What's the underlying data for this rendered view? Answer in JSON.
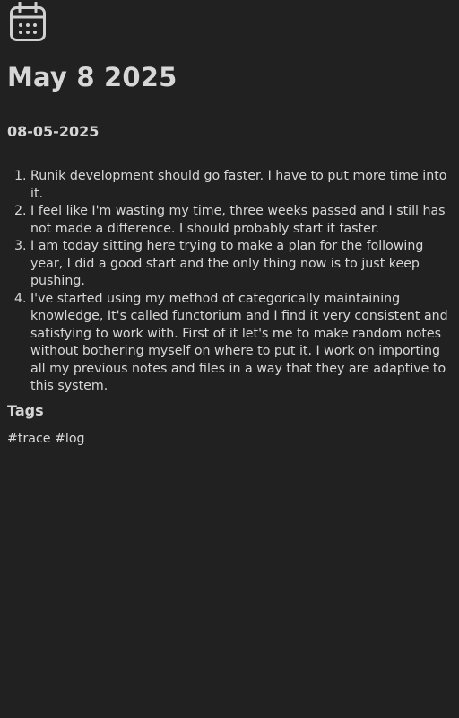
{
  "header": {
    "icon": "calendar-icon",
    "title": "May 8 2025"
  },
  "date_heading": "08-05-2025",
  "entries": [
    "Runik development should go faster. I have to put more time into it.",
    "I feel like I'm wasting my time, three weeks passed and I still has not made a difference. I should probably start it faster.",
    "I am today sitting here trying to make a plan for the following year, I did a good start and the only thing now is to just keep pushing.",
    "I've started using my method of categorically maintaining knowledge, It's called functorium and I find it very consistent and satisfying to work with. First of it let's me to make random notes without bothering myself on where to put it. I work on importing all my previous notes and files in a way that they are adaptive to this system."
  ],
  "tags_section": {
    "heading": "Tags",
    "tags": [
      "#trace",
      "#log"
    ]
  },
  "colors": {
    "background": "#212121",
    "text": "#d9d9d9"
  }
}
